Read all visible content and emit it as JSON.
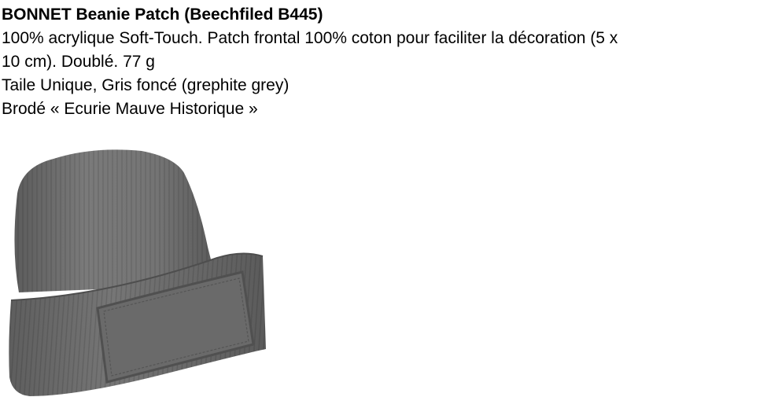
{
  "product": {
    "title": "BONNET Beanie Patch (Beechfiled B445)",
    "description_line1": "100% acrylique Soft-Touch. Patch frontal 100% coton pour faciliter la décoration (5 x",
    "description_line2": "10 cm). Doublé. 77 g",
    "size_color": "Taile Unique, Gris foncé (grephite grey)",
    "embroidery": "Brodé « Ecurie Mauve Historique »"
  },
  "image": {
    "subject": "beanie-hat-with-patch",
    "hat_color": "#6e6e6e"
  }
}
